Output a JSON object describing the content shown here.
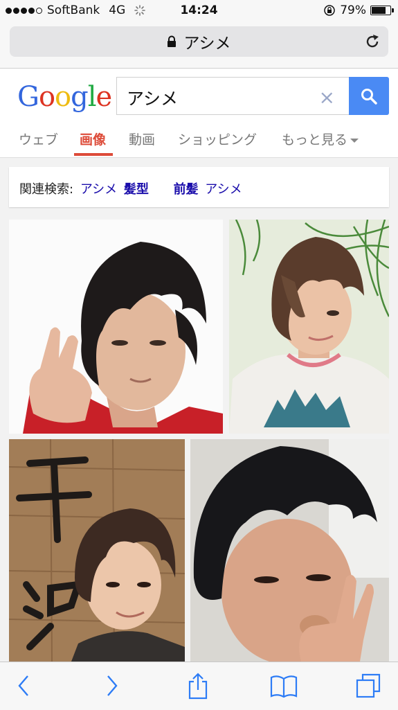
{
  "status_bar": {
    "carrier": "SoftBank",
    "network": "4G",
    "time": "14:24",
    "battery": "79%",
    "battery_level": 0.79,
    "signal_bars_filled": 4,
    "signal_bars_total": 5
  },
  "url_bar": {
    "address": "アシメ",
    "lock_icon": "lock-icon",
    "reload_icon": "reload-icon"
  },
  "google": {
    "logo_letters": [
      "G",
      "o",
      "o",
      "g",
      "l",
      "e"
    ],
    "query": "アシメ",
    "clear_icon": "×",
    "search_icon": "search-icon"
  },
  "tabs": [
    {
      "label": "ウェブ",
      "active": false
    },
    {
      "label": "画像",
      "active": true
    },
    {
      "label": "動画",
      "active": false
    },
    {
      "label": "ショッピング",
      "active": false
    },
    {
      "label": "もっと見る",
      "active": false
    }
  ],
  "related": {
    "label": "関連検索:",
    "items": [
      {
        "normal": "アシメ",
        "bold": "髪型"
      },
      {
        "bold": "前髪",
        "normal": "アシメ"
      }
    ]
  },
  "images": [
    {
      "alt": "man with dark bangs raising hand"
    },
    {
      "alt": "young man with brown swept hair"
    },
    {
      "alt": "man in front of wooden sign"
    },
    {
      "alt": "man with black hair and hand near mouth"
    }
  ],
  "toolbar": {
    "back_icon": "chevron-left-icon",
    "forward_icon": "chevron-right-icon",
    "share_icon": "share-icon",
    "bookmarks_icon": "book-icon",
    "tabs_icon": "tabs-icon"
  },
  "colors": {
    "accent": "#4a8af4",
    "active_tab": "#dd4b39",
    "link": "#1a0dab"
  }
}
